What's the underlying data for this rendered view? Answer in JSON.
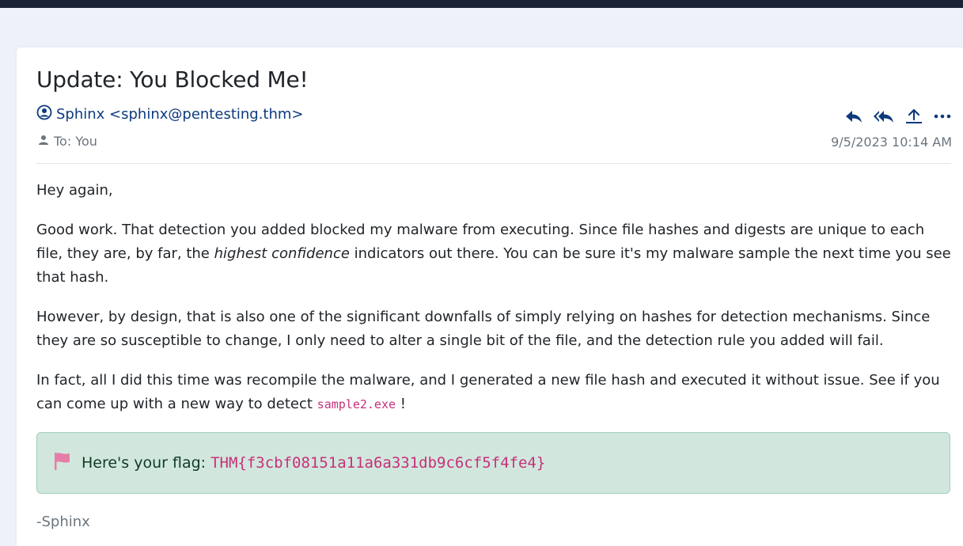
{
  "email": {
    "subject": "Update: You Blocked Me!",
    "from": "Sphinx <sphinx@pentesting.thm>",
    "to_label": "To: You",
    "date": "9/5/2023 10:14 AM",
    "actions": [
      {
        "name": "reply-icon"
      },
      {
        "name": "reply-all-icon"
      },
      {
        "name": "forward-icon"
      },
      {
        "name": "more-icon"
      }
    ]
  },
  "body": {
    "greeting": "Hey again,",
    "p1_start": "Good work. That detection you added blocked my malware from executing. Since file hashes and digests are unique to each file, they are, by far, the ",
    "p1_em": "highest confidence",
    "p1_end": " indicators out there. You can be sure it's my malware sample the next time you see that hash.",
    "p2": "However, by design, that is also one of the significant downfalls of simply relying on hashes for detection mechanisms. Since they are so susceptible to change, I only need to alter a single bit of the file, and the detection rule you added will fail.",
    "p3_start": "In fact, all I did this time was recompile the malware, and I generated a new file hash and executed it without issue. See if you can come up with a new way to detect ",
    "p3_code": "sample2.exe",
    "p3_end": " !"
  },
  "flag": {
    "icon": "flag-icon",
    "label": "Here's your flag:",
    "value": "THM{f3cbf08151a11a6a331db9c6cf5f4fe4}"
  },
  "signature": "-Sphinx",
  "colors": {
    "link": "#0d3a7d",
    "flag_bg": "#d1e7dd",
    "code": "#c7307a",
    "flag_icon": "#e57ea8"
  }
}
